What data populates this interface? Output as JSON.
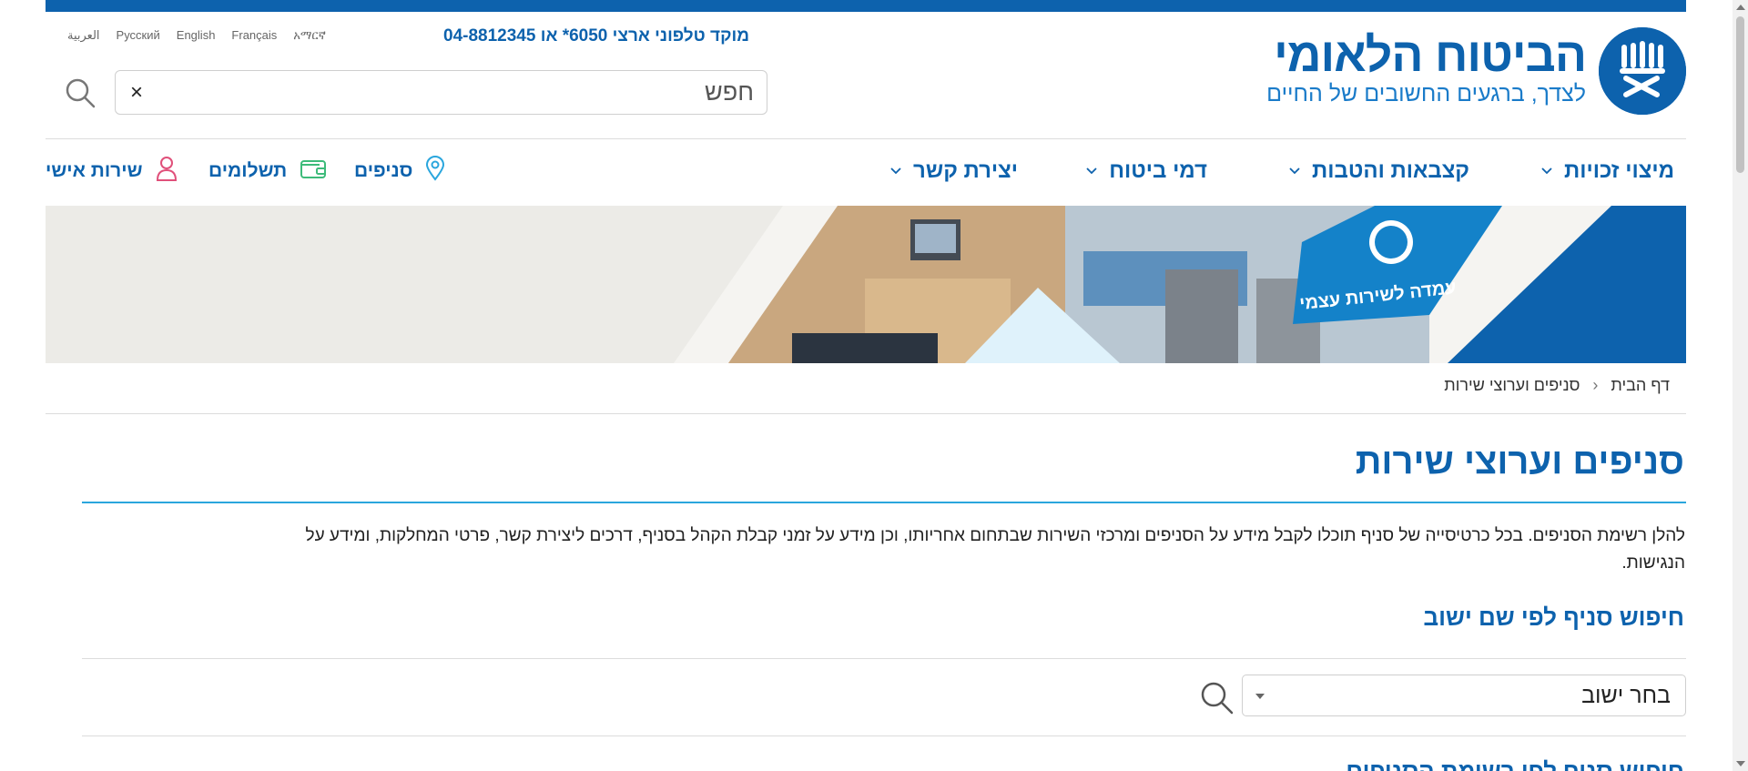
{
  "header": {
    "logo_name": "הביטוח הלאומי",
    "logo_tagline": "לצדך, ברגעים החשובים של החיים",
    "hotline": "מוקד טלפוני ארצי 6050* או 04-8812345",
    "languages": [
      "العربية",
      "Русский",
      "English",
      "Français",
      "አማርኛ"
    ],
    "search_placeholder": "חפש",
    "search_clear": "×"
  },
  "nav": {
    "main": [
      "מיצוי זכויות",
      "קצבאות והטבות",
      "דמי ביטוח",
      "יצירת קשר"
    ],
    "utility": [
      {
        "label": "סניפים",
        "icon": "location-pin-icon"
      },
      {
        "label": "תשלומים",
        "icon": "wallet-icon"
      },
      {
        "label": "שירות אישי",
        "icon": "user-icon"
      }
    ]
  },
  "banner": {
    "sign_text": "עמדה לשירות עצמי"
  },
  "breadcrumb": {
    "home": "דף הבית",
    "current": "סניפים וערוצי שירות"
  },
  "page": {
    "title": "סניפים וערוצי שירות",
    "intro": "להלן רשימת הסניפים. בכל כרטיסייה של סניף תוכלו לקבל מידע על  הסניפים ומרכזי השירות שבתחום אחריותו, וכן מידע על זמני קבלת הקהל בסניף, דרכים ליצירת קשר, פרטי המחלקות, ומידע על הנגישות.",
    "search_by_city_heading": "חיפוש סניף לפי שם ישוב",
    "city_select_value": "בחר ישוב",
    "next_heading": "חיפוש סניף לפי רשימת הסניפים"
  },
  "colors": {
    "brand_blue": "#0d62ad",
    "accent_line": "#2aa6dd",
    "wallet_green": "#3dbb7a",
    "user_pink": "#e0507a"
  }
}
